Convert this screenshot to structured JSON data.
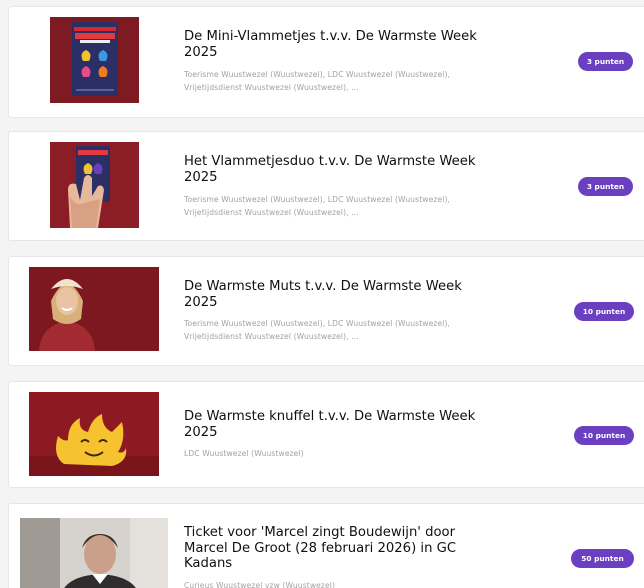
{
  "colors": {
    "badge_bg": "#6a3fc0",
    "title": "#101010",
    "subtitle": "#a1a1a8",
    "card_bg": "#ffffff",
    "page_bg": "#f4f4f5",
    "thumb_red": "#8f1a22"
  },
  "items": [
    {
      "title_line1": "De Mini-Vlammetjes t.v.v. De Warmste Week",
      "title_line2": "2025",
      "title_line3": "",
      "orgs_line1": "Toerisme Wuustwezel (Wuustwezel), LDC Wuustwezel (Wuustwezel),",
      "orgs_line2": "Vrijetijdsdienst Wuustwezel (Wuustwezel), ...",
      "points": "3 punten",
      "image_icon": "mini-vlammetjes-card-image"
    },
    {
      "title_line1": "Het Vlammetjesduo t.v.v. De Warmste Week",
      "title_line2": "2025",
      "title_line3": "",
      "orgs_line1": "Toerisme Wuustwezel (Wuustwezel), LDC Wuustwezel (Wuustwezel),",
      "orgs_line2": "Vrijetijdsdienst Wuustwezel (Wuustwezel), ...",
      "points": "3 punten",
      "image_icon": "hand-holding-card-image"
    },
    {
      "title_line1": "De Warmste Muts t.v.v. De Warmste Week",
      "title_line2": "2025",
      "title_line3": "",
      "orgs_line1": "Toerisme Wuustwezel (Wuustwezel), LDC Wuustwezel (Wuustwezel),",
      "orgs_line2": "Vrijetijdsdienst Wuustwezel (Wuustwezel), ...",
      "points": "10 punten",
      "image_icon": "woman-with-hat-image"
    },
    {
      "title_line1": "De Warmste knuffel t.v.v. De Warmste Week",
      "title_line2": "2025",
      "title_line3": "",
      "orgs_line1": "LDC Wuustwezel (Wuustwezel)",
      "orgs_line2": "",
      "points": "10 punten",
      "image_icon": "flame-plush-image"
    },
    {
      "title_line1": "Ticket voor 'Marcel zingt Boudewijn' door",
      "title_line2": "Marcel De Groot (28 februari 2026) in GC",
      "title_line3": "Kadans",
      "orgs_line1": "Curieus Wuustwezel vzw (Wuustwezel)",
      "orgs_line2": "",
      "points": "50 punten",
      "image_icon": "singer-portrait-image"
    }
  ]
}
